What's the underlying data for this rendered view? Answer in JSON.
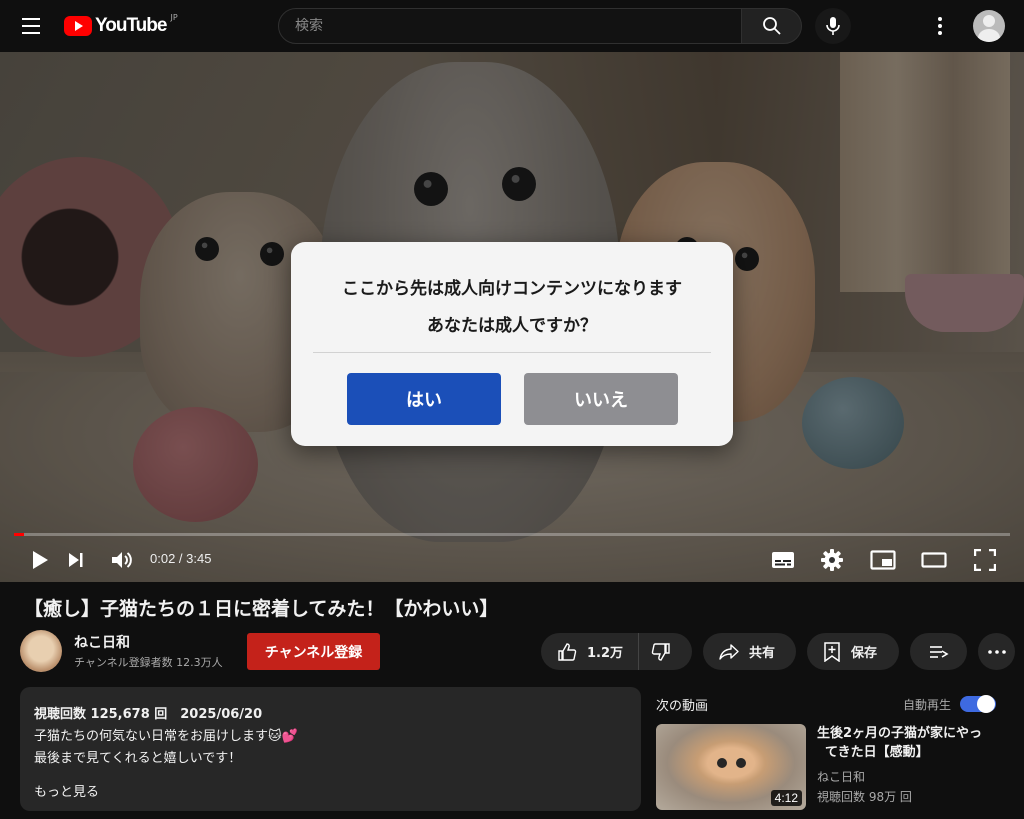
{
  "header": {
    "logo_text": "YouTube",
    "region": "JP",
    "search_placeholder": "検索"
  },
  "dialog": {
    "line1": "ここから先は成人向けコンテンツになります",
    "line2": "あなたは成人ですか？",
    "yes_label": "はい",
    "no_label": "いいえ",
    "yes_color": "#1b4fb8",
    "no_color": "#8e8e92"
  },
  "player": {
    "time_display": "0:02 / 3:45",
    "progress_fraction": 0.01
  },
  "video": {
    "title": "【癒し】子猫たちの１日に密着してみた！【かわいい】",
    "channel_name": "ねこ日和",
    "subscriber_text": "チャンネル登録者数 12.3万人",
    "subscribe_label": "チャンネル登録",
    "like_count": "1.2万",
    "share_label": "共有",
    "save_label": "保存"
  },
  "description": {
    "meta": "視聴回数 125,678 回　2025/06/20",
    "lines": [
      "子猫たちの何気ない日常をお届けします🐱💕",
      "最後まで見てくれると嬉しいです！"
    ],
    "more_label": "もっと見る"
  },
  "sidebar": {
    "next_label": "次の動画",
    "autoplay_label": "自動再生",
    "autoplay_on": true,
    "recommended": [
      {
        "title_line1": "生後2ヶ月の子猫が家にやっ",
        "title_line2": "てきた日【感動】",
        "channel": "ねこ日和",
        "views": "視聴回数 98万 回",
        "duration": "4:12"
      }
    ]
  },
  "colors": {
    "accent_red": "#ff0000",
    "subscribe_red": "#c4221a",
    "toggle_blue": "#3e6ae1"
  },
  "icons": [
    "menu-icon",
    "search-icon",
    "mic-icon",
    "more-vert-icon",
    "account-icon",
    "play-icon",
    "next-icon",
    "volume-icon",
    "subtitles-icon",
    "settings-icon",
    "miniplayer-icon",
    "theater-icon",
    "fullscreen-icon",
    "thumbs-up-icon",
    "thumbs-down-icon",
    "share-icon",
    "save-icon",
    "add-to-queue-icon",
    "more-horiz-icon"
  ]
}
